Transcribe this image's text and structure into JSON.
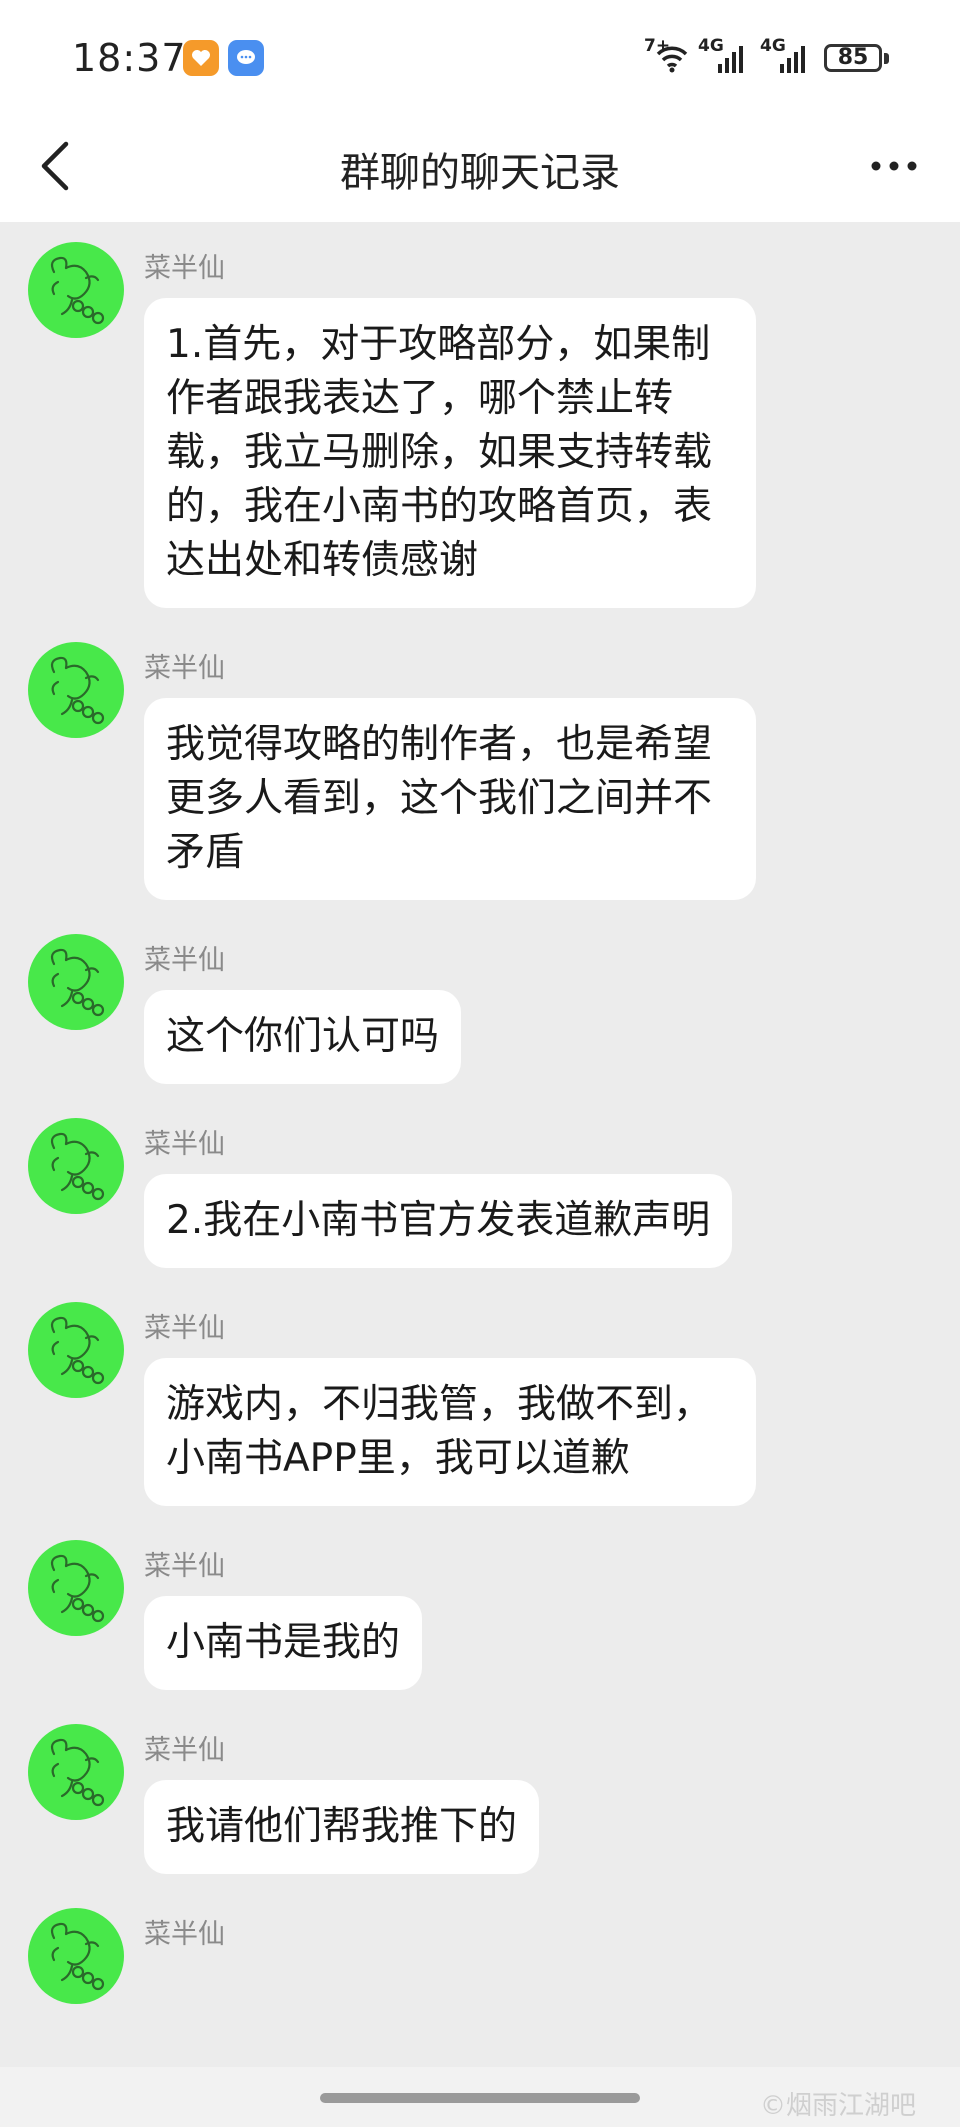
{
  "status_bar": {
    "time": "18:37",
    "app_icons": [
      "heart-app-icon",
      "chat-bubble-app-icon"
    ],
    "wifi": "7+",
    "signal1": "4G",
    "signal2": "4G",
    "battery": "85"
  },
  "nav": {
    "title": "群聊的聊天记录",
    "back_icon": "chevron-left-icon",
    "more_icon": "more-dots-icon"
  },
  "messages": [
    {
      "sender": "菜半仙",
      "text": "1.首先，对于攻略部分，如果制作者跟我表达了，哪个禁止转载，我立马删除，如果支持转载的，我在小南书的攻略首页，表达出处和转债感谢"
    },
    {
      "sender": "菜半仙",
      "text": "我觉得攻略的制作者，也是希望更多人看到，这个我们之间并不矛盾"
    },
    {
      "sender": "菜半仙",
      "text": "这个你们认可吗"
    },
    {
      "sender": "菜半仙",
      "text": "2.我在小南书官方发表道歉声明"
    },
    {
      "sender": "菜半仙",
      "text": "游戏内，不归我管，我做不到，小南书APP里，我可以道歉"
    },
    {
      "sender": "菜半仙",
      "text": "小南书是我的"
    },
    {
      "sender": "菜半仙",
      "text": "我请他们帮我推下的"
    },
    {
      "sender": "菜半仙",
      "text": ""
    }
  ],
  "watermark": "©烟雨江湖吧",
  "colors": {
    "avatar_bg": "#48e84a",
    "chat_bg": "#ececec",
    "bubble_bg": "#ffffff",
    "name_color": "#8a8a8a"
  }
}
